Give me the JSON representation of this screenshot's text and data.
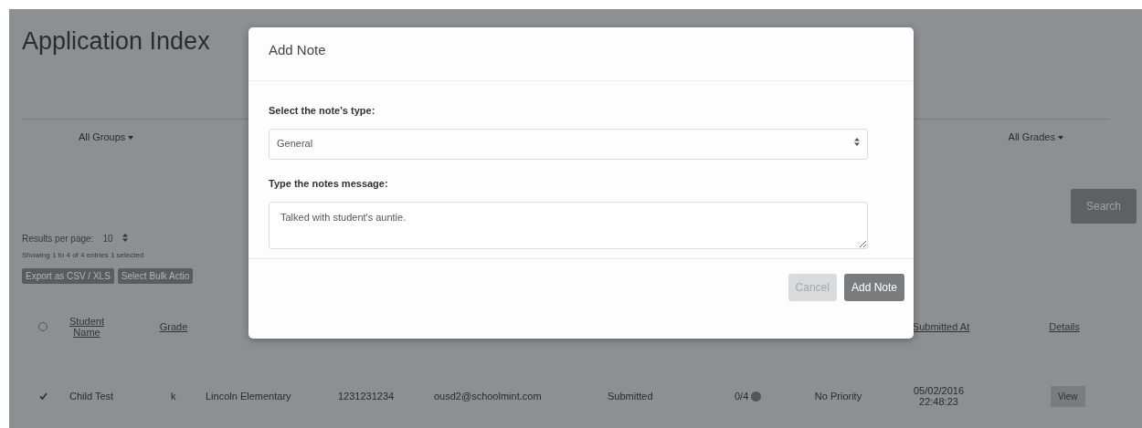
{
  "page": {
    "title": "Application Index"
  },
  "filters": [
    {
      "label": "All Groups"
    },
    {
      "label": "All Grades"
    }
  ],
  "search_button": "Search",
  "results_per_page": {
    "label": "Results per page:",
    "value": "10"
  },
  "summary": "Showing 1 to 4 of 4 entries 1 selected",
  "actions": [
    "Export as CSV / XLS",
    "Select Bulk Actio"
  ],
  "table": {
    "columns": [
      "Student Name",
      "Grade",
      "",
      "",
      "",
      "",
      "",
      "",
      "Submitted At",
      "Details"
    ],
    "rows": [
      {
        "selected": true,
        "cells": [
          "Child Test",
          "k",
          "Lincoln Elementary",
          "1231231234",
          "ousd2@schoolmint.com",
          "Submitted",
          "0/4",
          "No Priority",
          "05/02/2016 22:48:23"
        ],
        "action": "View"
      }
    ]
  },
  "modal": {
    "title": "Add Note",
    "type_label": "Select the note's type:",
    "type_value": "General",
    "message_label": "Type the notes message:",
    "message_value": "Talked with student's auntie.",
    "buttons": [
      {
        "label": "Cancel",
        "kind": "secondary"
      },
      {
        "label": "Add Note",
        "kind": "primary"
      }
    ]
  }
}
